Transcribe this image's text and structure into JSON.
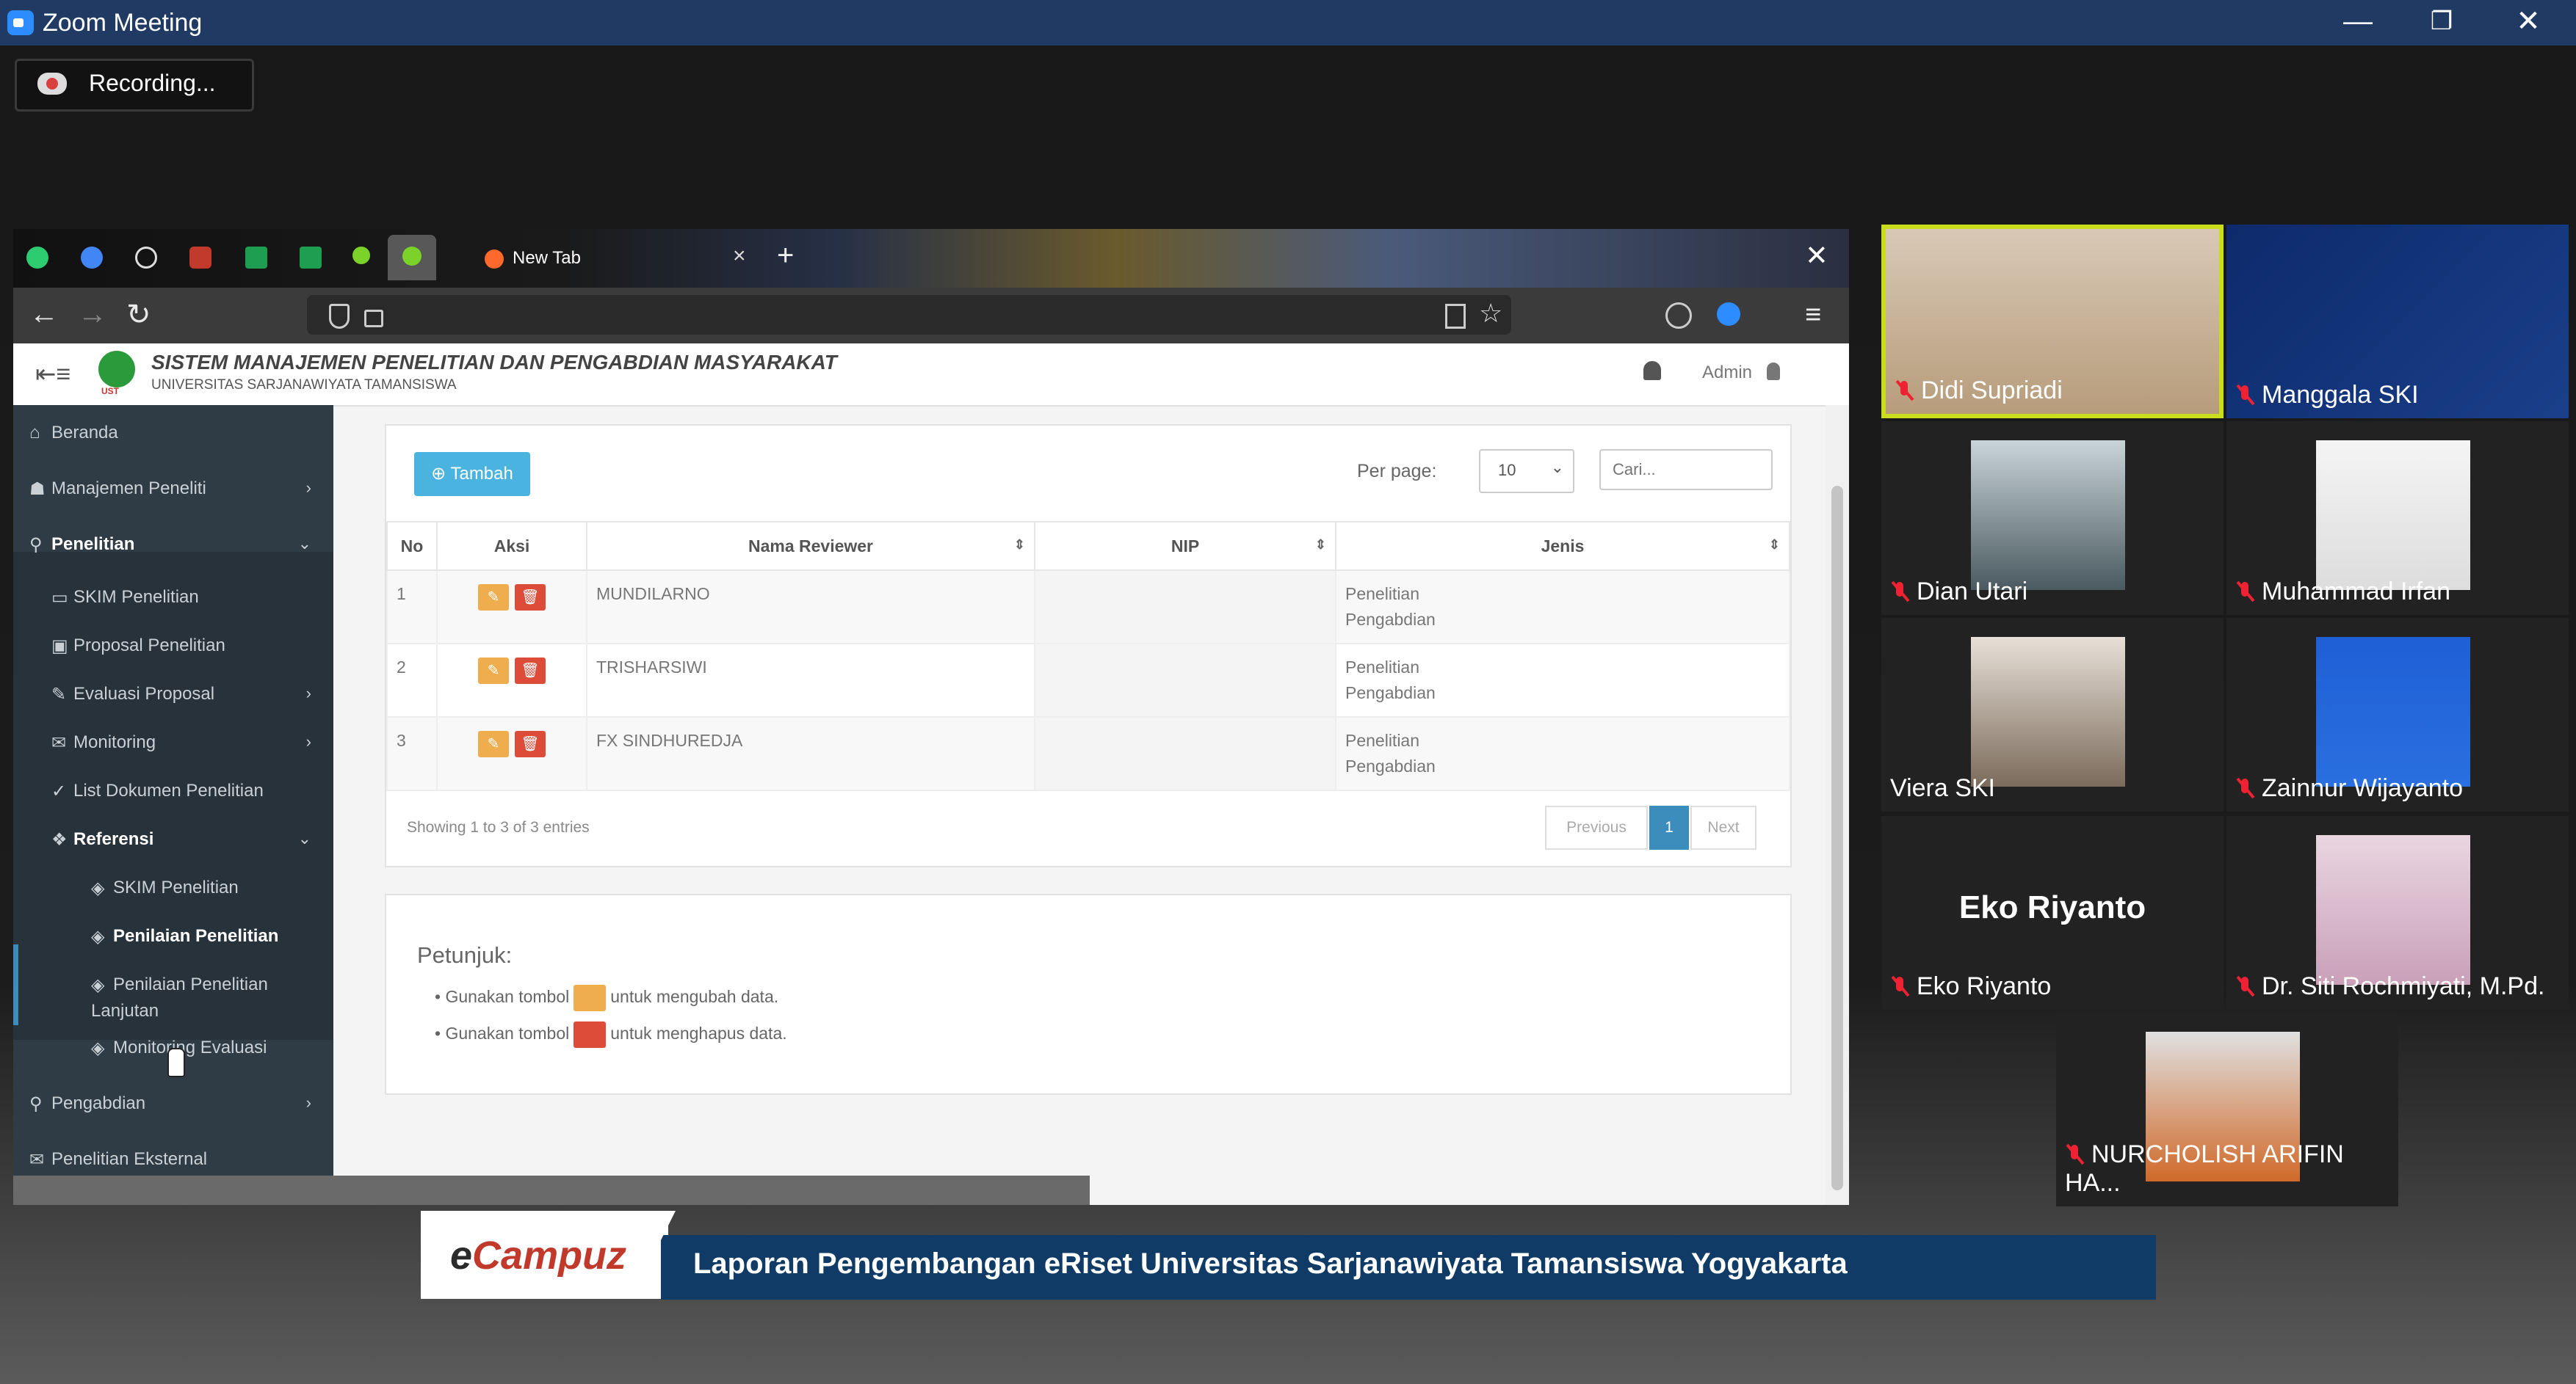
{
  "window": {
    "title": "Zoom Meeting",
    "minimize": "—",
    "maximize": "❐",
    "close": "✕"
  },
  "recording": {
    "label": "Recording..."
  },
  "browser": {
    "tab_label": "New Tab",
    "tab_close": "×",
    "new_tab": "+",
    "close": "✕",
    "back": "←",
    "forward": "→",
    "reload": "↻",
    "star": "☆",
    "menu": "≡"
  },
  "app": {
    "hamburger": "⇤≡",
    "logo_text": "UST",
    "title": "SISTEM MANAJEMEN PENELITIAN DAN PENGABDIAN MASYARAKAT",
    "subtitle": "UNIVERSITAS SARJANAWIYATA TAMANSISWA",
    "user": "Admin"
  },
  "sidebar": {
    "items": [
      {
        "label": "Beranda",
        "icon": "home-icon",
        "glyph": "⌂"
      },
      {
        "label": "Manajemen Peneliti",
        "icon": "user-icon",
        "glyph": "☗",
        "arrow": "›"
      },
      {
        "label": "Penelitian",
        "icon": "search-icon",
        "glyph": "⚲",
        "arrow": "⌄"
      },
      {
        "label": "SKIM Penelitian",
        "icon": "monitor-icon",
        "glyph": "▭"
      },
      {
        "label": "Proposal Penelitian",
        "icon": "briefcase-icon",
        "glyph": "▣"
      },
      {
        "label": "Evaluasi Proposal",
        "icon": "edit-icon",
        "glyph": "✎",
        "arrow": "›"
      },
      {
        "label": "Monitoring",
        "icon": "envelope-icon",
        "glyph": "✉",
        "arrow": "›"
      },
      {
        "label": "List Dokumen Penelitian",
        "icon": "check-icon",
        "glyph": "✓"
      },
      {
        "label": "Referensi",
        "icon": "cubes-icon",
        "glyph": "❖",
        "arrow": "⌄"
      },
      {
        "label": "SKIM Penelitian",
        "icon": "cube-icon",
        "glyph": "◈"
      },
      {
        "label": "Penilaian Penelitian",
        "icon": "cube-icon",
        "glyph": "◈"
      },
      {
        "label": "Penilaian Penelitian",
        "label2": "Lanjutan",
        "icon": "cube-icon",
        "glyph": "◈"
      },
      {
        "label": "Monitoring Evaluasi",
        "icon": "cube-icon",
        "glyph": "◈"
      },
      {
        "label": "Pengabdian",
        "icon": "search-icon",
        "glyph": "⚲",
        "arrow": "›"
      },
      {
        "label": "Penelitian Eksternal",
        "icon": "envelope-icon",
        "glyph": "✉"
      }
    ]
  },
  "toolbar": {
    "add_label": "Tambah",
    "per_page_label": "Per page:",
    "per_page_value": "10",
    "caret": "⌄",
    "search_placeholder": "Cari..."
  },
  "table": {
    "headers": [
      "No",
      "Aksi",
      "Nama Reviewer",
      "NIP",
      "Jenis"
    ],
    "sort_glyph": "⇕",
    "rows": [
      {
        "no": "1",
        "name": "MUNDILARNO",
        "nip": "",
        "jenis1": "Penelitian",
        "jenis2": "Pengabdian"
      },
      {
        "no": "2",
        "name": "TRISHARSIWI",
        "nip": "",
        "jenis1": "Penelitian",
        "jenis2": "Pengabdian"
      },
      {
        "no": "3",
        "name": "FX SINDHUREDJA",
        "nip": "",
        "jenis1": "Penelitian",
        "jenis2": "Pengabdian"
      }
    ],
    "edit_glyph": "✎",
    "delete_glyph": "🗑"
  },
  "footer": {
    "showing": "Showing 1 to 3 of 3 entries",
    "prev": "Previous",
    "page": "1",
    "next": "Next"
  },
  "hint": {
    "title": "Petunjuk:",
    "line1_pre": "Gunakan tombol",
    "line1_post": "untuk mengubah data.",
    "line2_pre": "Gunakan tombol",
    "line2_post": "untuk menghapus data."
  },
  "participants": [
    {
      "name": "Didi Supriadi",
      "muted": true,
      "active": true
    },
    {
      "name": "Manggala SKI",
      "muted": true
    },
    {
      "name": "Dian Utari",
      "muted": true
    },
    {
      "name": "Muhammad Irfan",
      "muted": true
    },
    {
      "name": "Viera SKI",
      "muted": false
    },
    {
      "name": "Zainnur Wijayanto",
      "muted": true
    },
    {
      "name": "Eko Riyanto",
      "muted": true,
      "big_label": "Eko Riyanto"
    },
    {
      "name": "Dr. Siti Rochmiyati, M.Pd.",
      "muted": true
    },
    {
      "name": "NURCHOLISH ARIFIN HA...",
      "muted": true
    }
  ],
  "caption": {
    "logo_e": "e",
    "logo_rest": "Campuz",
    "text": "Laporan Pengembangan eRiset Universitas Sarjanawiyata Tamansiswa Yogyakarta"
  },
  "colors": {
    "titlebar": "#203a63",
    "accent": "#4bb3df",
    "edit": "#f0ad4e",
    "delete": "#dd4b39",
    "sidebar": "#2f3b45",
    "active_speaker": "#c9dd1c",
    "caption": "#0f3b66"
  }
}
